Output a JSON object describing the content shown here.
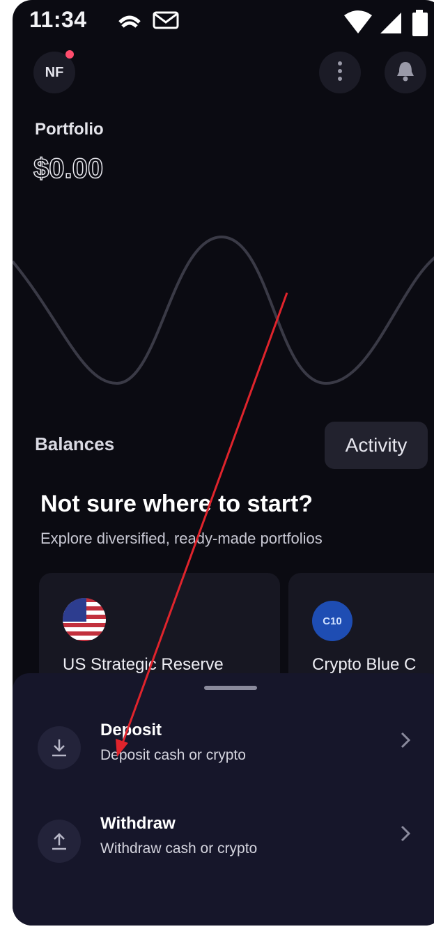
{
  "status_bar": {
    "time": "11:34"
  },
  "header": {
    "avatar_initials": "NF"
  },
  "portfolio": {
    "label": "Portfolio",
    "value": "$0.00"
  },
  "balances": {
    "label": "Balances",
    "activity_label": "Activity"
  },
  "promo": {
    "title": "Not sure where to start?",
    "subtitle": "Explore diversified, ready-made portfolios",
    "cards": [
      {
        "label": "US Strategic Reserve",
        "icon": "us-flag-icon"
      },
      {
        "label": "Crypto Blue C",
        "icon_text": "C10"
      }
    ]
  },
  "sheet": {
    "items": [
      {
        "title": "Deposit",
        "subtitle": "Deposit cash or crypto",
        "icon": "download-icon"
      },
      {
        "title": "Withdraw",
        "subtitle": "Withdraw cash or crypto",
        "icon": "upload-icon"
      }
    ]
  },
  "colors": {
    "background": "#0b0b12",
    "sheet": "#16162a",
    "annotation_arrow": "#e0242c",
    "notification_dot": "#ff4d6d"
  }
}
